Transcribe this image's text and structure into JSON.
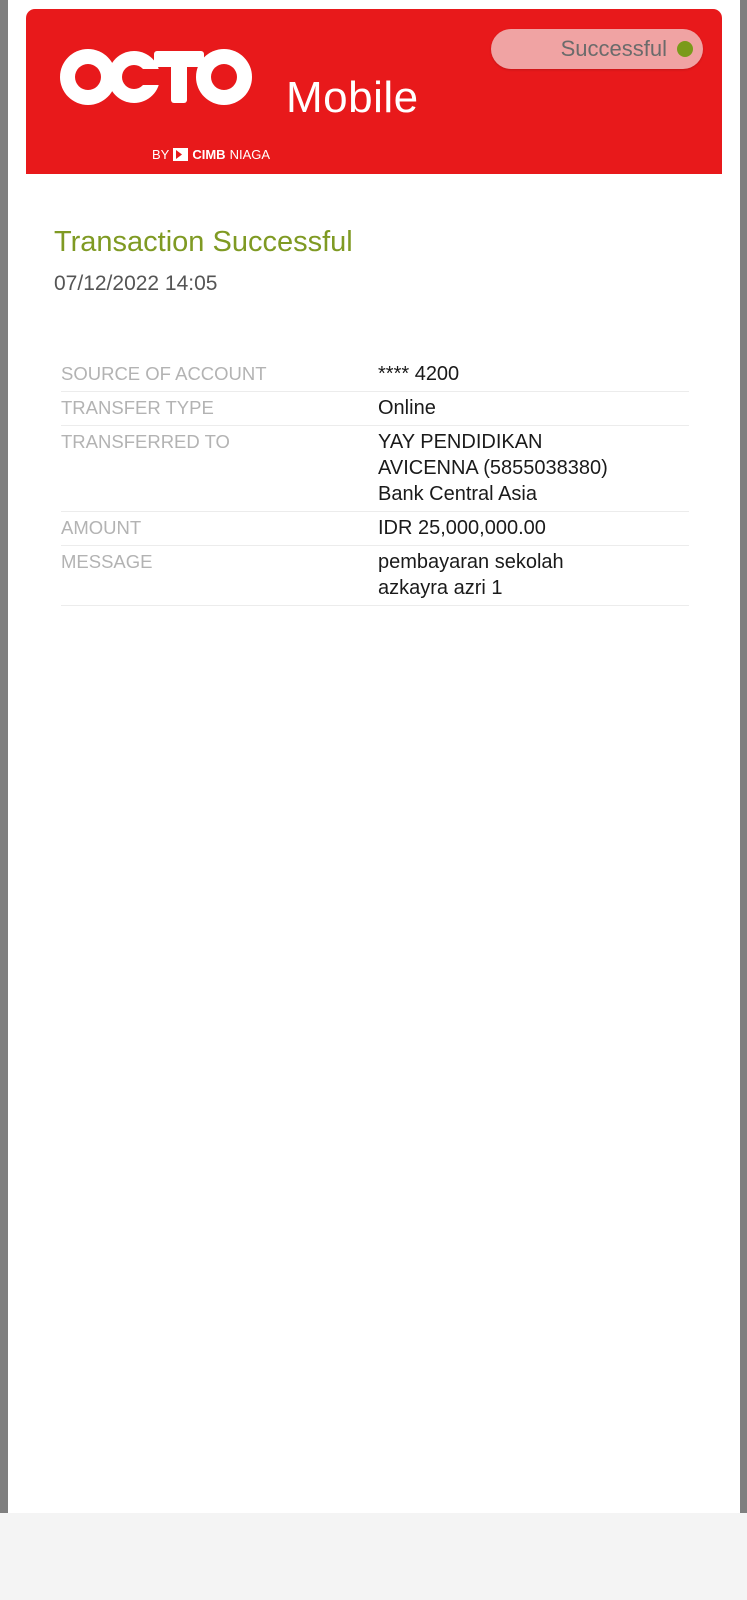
{
  "app": {
    "logo_text": "OCTO",
    "logo_mobile": "Mobile",
    "logo_by": "BY",
    "logo_bank_bold": "CIMB",
    "logo_bank": "NIAGA",
    "brand_color": "#e8191b"
  },
  "status": {
    "label": "Successful",
    "dot_color": "#7a9a1a"
  },
  "transaction": {
    "title": "Transaction Successful",
    "title_color": "#7f9a23",
    "datetime": "07/12/2022 14:05"
  },
  "details": [
    {
      "key": "SOURCE OF ACCOUNT",
      "value": "**** 4200"
    },
    {
      "key": "TRANSFER TYPE",
      "value": "Online"
    },
    {
      "key": "TRANSFERRED TO",
      "value": "YAY PENDIDIKAN\nAVICENNA  (5855038380)\nBank Central Asia"
    },
    {
      "key": "AMOUNT",
      "value": "IDR 25,000,000.00"
    },
    {
      "key": "MESSAGE",
      "value": "pembayaran sekolah\nazkayra azri 1"
    }
  ]
}
